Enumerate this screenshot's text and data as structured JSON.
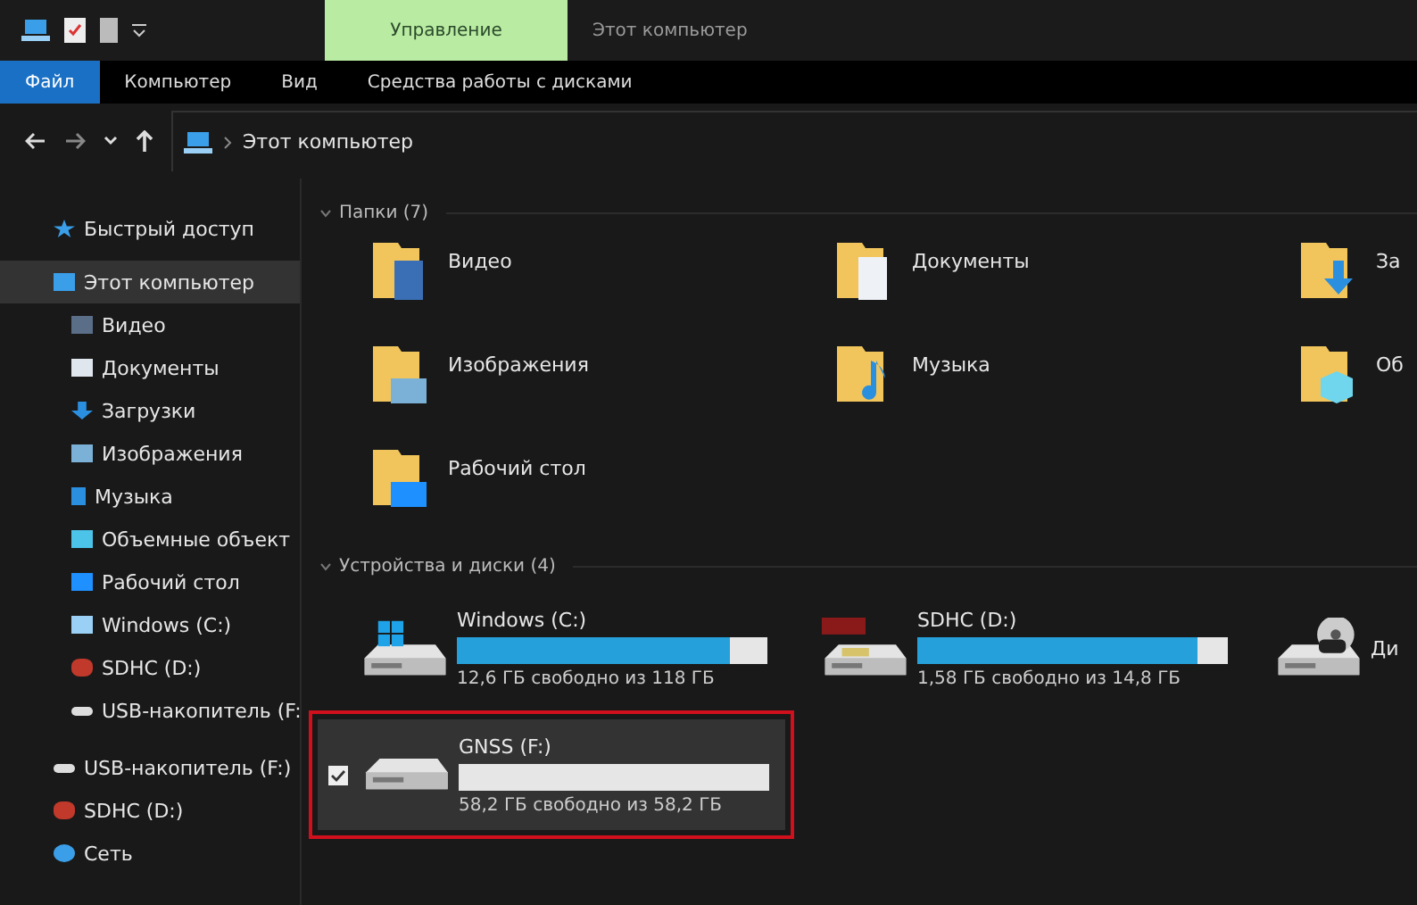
{
  "title_bar": {
    "context_tab": "Управление",
    "title": "Этот компьютер"
  },
  "ribbon_tabs": [
    {
      "label": "Файл",
      "selected": true
    },
    {
      "label": "Компьютер",
      "selected": false
    },
    {
      "label": "Вид",
      "selected": false
    },
    {
      "label": "Средства работы с дисками",
      "selected": false
    }
  ],
  "address_bar": {
    "path": "Этот компьютер"
  },
  "sidebar": {
    "items": [
      {
        "label": "Быстрый доступ",
        "kind": "star",
        "selected": false
      },
      {
        "label": "Этот компьютер",
        "kind": "pc",
        "selected": true,
        "children": [
          {
            "label": "Видео",
            "kind": "video",
            "selected": false
          },
          {
            "label": "Документы",
            "kind": "docs",
            "selected": false
          },
          {
            "label": "Загрузки",
            "kind": "download",
            "selected": false
          },
          {
            "label": "Изображения",
            "kind": "pictures",
            "selected": false
          },
          {
            "label": "Музыка",
            "kind": "music",
            "selected": false
          },
          {
            "label": "Объемные объект",
            "kind": "objects",
            "selected": false
          },
          {
            "label": "Рабочий стол",
            "kind": "desktop",
            "selected": false
          },
          {
            "label": "Windows (C:)",
            "kind": "windows-drive",
            "selected": false
          },
          {
            "label": "SDHC (D:)",
            "kind": "sd-drive",
            "selected": false
          },
          {
            "label": "USB-накопитель (F:",
            "kind": "usb-drive",
            "selected": false
          }
        ]
      },
      {
        "label": "USB-накопитель (F:)",
        "kind": "usb-drive",
        "selected": false
      },
      {
        "label": "SDHC (D:)",
        "kind": "sd-drive",
        "selected": false
      },
      {
        "label": "Сеть",
        "kind": "network",
        "selected": false
      }
    ]
  },
  "folders": {
    "heading": "Папки (7)",
    "items": [
      {
        "label": "Видео",
        "kind": "video"
      },
      {
        "label": "Документы",
        "kind": "docs"
      },
      {
        "label": "За",
        "kind": "download"
      },
      {
        "label": "Изображения",
        "kind": "pictures"
      },
      {
        "label": "Музыка",
        "kind": "music"
      },
      {
        "label": "Об",
        "kind": "objects"
      },
      {
        "label": "Рабочий стол",
        "kind": "desktop"
      }
    ]
  },
  "drives": {
    "heading": "Устройства и диски (4)",
    "items": [
      {
        "name": "Windows (C:)",
        "kind": "windows-drive",
        "level": 0.88,
        "free": "12,6 ГБ свободно из 118 ГБ",
        "selected": false,
        "checked": false,
        "highlighted": false
      },
      {
        "name": "SDHC (D:)",
        "kind": "sd-drive",
        "level": 0.9,
        "free": "1,58 ГБ свободно из 14,8 ГБ",
        "selected": false,
        "checked": false,
        "highlighted": false
      },
      {
        "name": "Ди",
        "kind": "bd-drive",
        "selected": false,
        "checked": false,
        "highlighted": false
      },
      {
        "name": "GNSS (F:)",
        "kind": "usb-drive",
        "level": 0,
        "free": "58,2 ГБ свободно из 58,2 ГБ",
        "selected": true,
        "checked": true,
        "highlighted": true
      }
    ]
  }
}
